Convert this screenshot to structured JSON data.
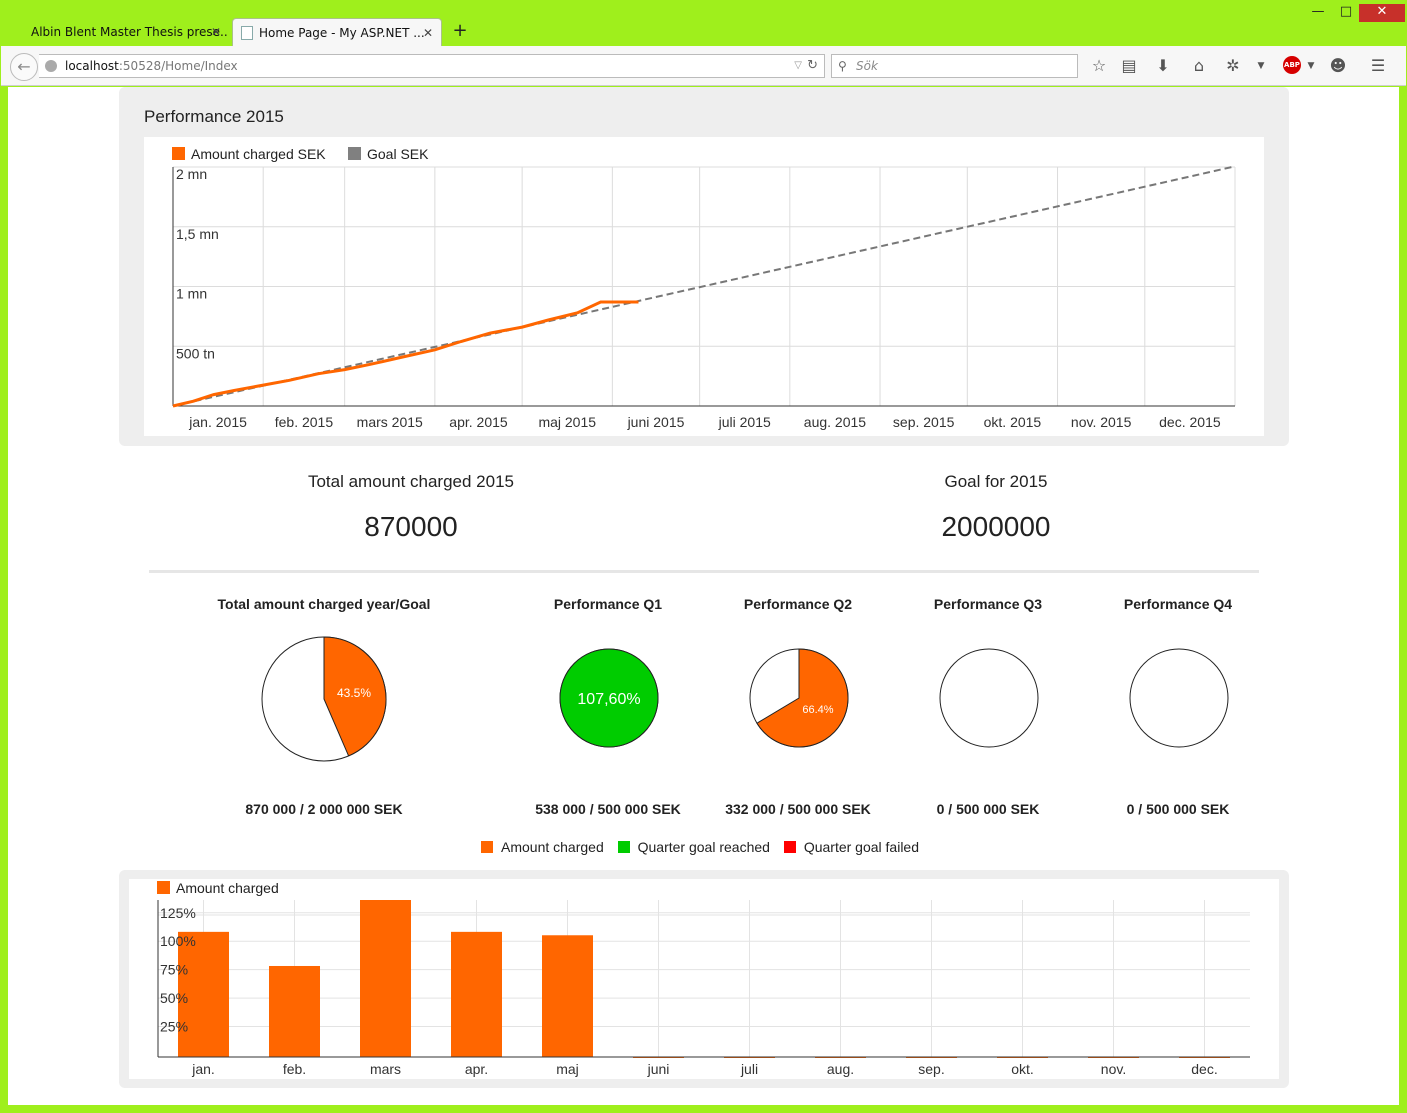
{
  "browser": {
    "tabs": [
      {
        "label": "Albin Blent Master Thesis prese...",
        "active": false
      },
      {
        "label": "Home Page - My ASP.NET ...",
        "active": true
      }
    ],
    "url_host": "localhost",
    "url_path": ":50528/Home/Index",
    "search_placeholder": "Sök",
    "window_controls": {
      "minimize": "—",
      "maximize": "□",
      "close": "✕"
    },
    "toolbar_icons": [
      "star-icon",
      "reading-list-icon",
      "download-icon",
      "home-icon",
      "extension-icon",
      "adblock-icon",
      "chat-icon",
      "menu-icon"
    ],
    "abp_label": "ABP"
  },
  "performance": {
    "title": "Performance 2015",
    "legend": [
      {
        "label": "Amount charged SEK",
        "color": "#ff6600"
      },
      {
        "label": "Goal SEK",
        "color": "#808080"
      }
    ]
  },
  "kpis": {
    "total_title": "Total amount charged 2015",
    "total_value": "870000",
    "goal_title": "Goal for 2015",
    "goal_value": "2000000"
  },
  "pies": [
    {
      "title": "Total amount charged year/Goal",
      "label": "43.5%",
      "caption": "870 000 / 2 000 000 SEK"
    },
    {
      "title": "Performance Q1",
      "label": "107,60%",
      "caption": "538 000 / 500 000 SEK"
    },
    {
      "title": "Performance Q2",
      "label": "66.4%",
      "caption": "332 000 / 500 000 SEK"
    },
    {
      "title": "Performance Q3",
      "label": "",
      "caption": "0 / 500 000 SEK"
    },
    {
      "title": "Performance Q4",
      "label": "",
      "caption": "0 / 500 000 SEK"
    }
  ],
  "pie_legend": [
    {
      "label": "Amount charged",
      "color": "#ff6600"
    },
    {
      "label": "Quarter goal reached",
      "color": "#00cc00"
    },
    {
      "label": "Quarter goal failed",
      "color": "#ff0000"
    }
  ],
  "monthly": {
    "legend": "Amount charged"
  },
  "chart_data": [
    {
      "type": "line",
      "title": "Performance 2015",
      "x_tick_labels": [
        "jan. 2015",
        "feb. 2015",
        "mars 2015",
        "apr. 2015",
        "maj 2015",
        "juni 2015",
        "juli 2015",
        "aug. 2015",
        "sep. 2015",
        "okt. 2015",
        "nov. 2015",
        "dec. 2015"
      ],
      "y_tick_labels": [
        "500 tn",
        "1 mn",
        "1,5 mn",
        "2 mn"
      ],
      "ylim": [
        0,
        2000000
      ],
      "xlim": [
        "2015-01-01",
        "2016-01-01"
      ],
      "series": [
        {
          "name": "Amount charged SEK",
          "x": [
            "2015-01-01",
            "2015-01-08",
            "2015-01-15",
            "2015-01-22",
            "2015-02-01",
            "2015-02-10",
            "2015-02-20",
            "2015-03-01",
            "2015-03-10",
            "2015-03-20",
            "2015-04-01",
            "2015-04-10",
            "2015-04-20",
            "2015-05-01",
            "2015-05-10",
            "2015-05-20",
            "2015-05-28",
            "2015-06-10"
          ],
          "y": [
            0,
            40000,
            95000,
            130000,
            175000,
            215000,
            270000,
            305000,
            350000,
            405000,
            470000,
            540000,
            610000,
            660000,
            720000,
            780000,
            870000,
            870000
          ]
        },
        {
          "name": "Goal SEK",
          "x": [
            "2015-01-01",
            "2015-12-31"
          ],
          "y": [
            0,
            2000000
          ],
          "dashed": true
        }
      ]
    },
    {
      "type": "pie",
      "title": "Total amount charged year/Goal",
      "slices": [
        {
          "label": "Amount charged",
          "value": 43.5
        },
        {
          "label": "Remaining",
          "value": 56.5
        }
      ]
    },
    {
      "type": "pie",
      "title": "Performance Q1",
      "slices": [
        {
          "label": "Quarter goal reached",
          "value": 107.6
        }
      ]
    },
    {
      "type": "pie",
      "title": "Performance Q2",
      "slices": [
        {
          "label": "Amount charged",
          "value": 66.4
        },
        {
          "label": "Remaining",
          "value": 33.6
        }
      ]
    },
    {
      "type": "pie",
      "title": "Performance Q3",
      "slices": []
    },
    {
      "type": "pie",
      "title": "Performance Q4",
      "slices": []
    },
    {
      "type": "bar",
      "series": [
        {
          "name": "Amount charged",
          "values": [
            110,
            80,
            138,
            110,
            107,
            0,
            0,
            0,
            0,
            0,
            0,
            0
          ]
        }
      ],
      "categories": [
        "jan.",
        "feb.",
        "mars",
        "apr.",
        "maj",
        "juni",
        "juli",
        "aug.",
        "sep.",
        "okt.",
        "nov.",
        "dec."
      ],
      "y_tick_labels": [
        "25%",
        "50%",
        "75%",
        "100%",
        "125%"
      ],
      "ylim": [
        0,
        138
      ]
    }
  ]
}
